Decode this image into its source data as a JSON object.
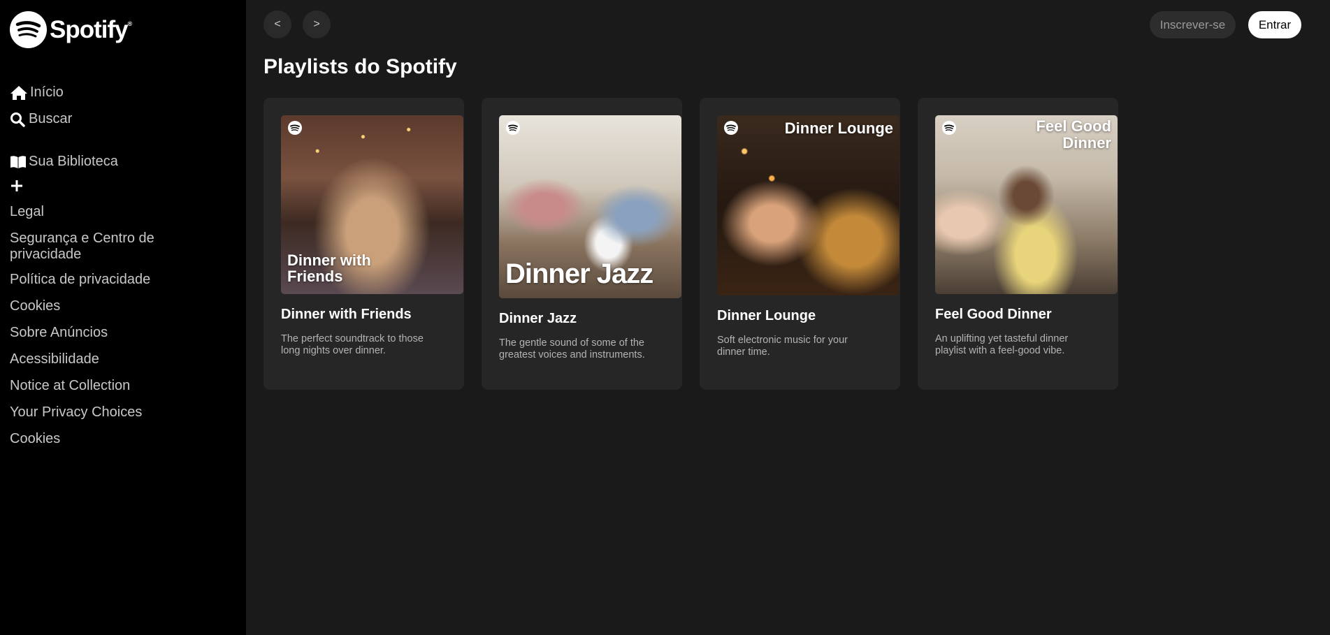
{
  "brand": {
    "name": "Spotify",
    "trademark": "®"
  },
  "sidebar": {
    "nav": [
      {
        "label": "Início",
        "icon": "home-icon"
      },
      {
        "label": "Buscar",
        "icon": "search-icon"
      },
      {
        "label": "Sua Biblioteca",
        "icon": "library-icon"
      }
    ],
    "legal": [
      "Legal",
      "Segurança e Centro de privacidade",
      "Política de privacidade",
      "Cookies",
      "Sobre Anúncios",
      "Acessibilidade",
      "Notice at Collection",
      "Your Privacy Choices",
      "Cookies"
    ]
  },
  "header": {
    "back_label": "<",
    "forward_label": ">",
    "signup_label": "Inscrever-se",
    "login_label": "Entrar"
  },
  "main": {
    "section_title": "Playlists do Spotify",
    "playlists": [
      {
        "title": "Dinner with Friends",
        "description": "The perfect soundtrack to those long nights over dinner.",
        "cover_text": "Dinner with Friends"
      },
      {
        "title": "Dinner Jazz",
        "description": "The gentle sound of some of the greatest voices and instruments.",
        "cover_text": "Dinner Jazz"
      },
      {
        "title": "Dinner Lounge",
        "description": "Soft electronic music for your dinner time.",
        "cover_text": "Dinner Lounge"
      },
      {
        "title": "Feel Good Dinner",
        "description": "An uplifting yet tasteful dinner playlist with a feel-good vibe.",
        "cover_text": "Feel Good Dinner"
      }
    ]
  },
  "colors": {
    "sidebar_bg": "#000000",
    "main_bg": "#1a1a1a",
    "card_bg": "#262626",
    "text_muted": "#b3b3b3"
  }
}
